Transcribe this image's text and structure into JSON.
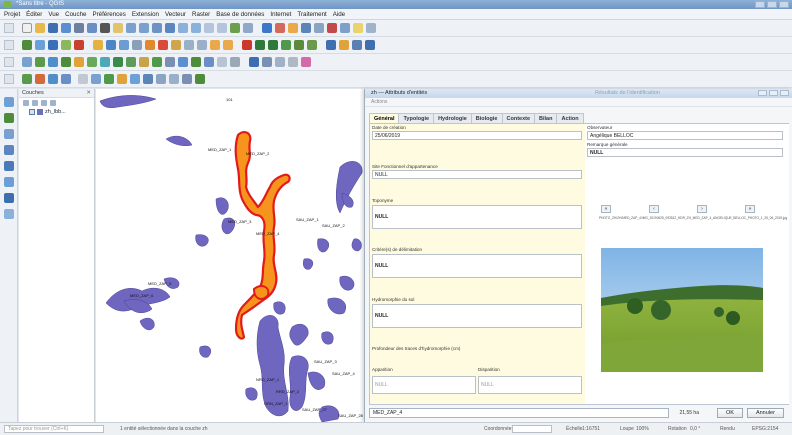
{
  "window": {
    "title": "*Sans titre - QGIS"
  },
  "menu": [
    "Projet",
    "Éditer",
    "Vue",
    "Couche",
    "Préférences",
    "Extension",
    "Vecteur",
    "Raster",
    "Base de données",
    "Internet",
    "Traitement",
    "Aide"
  ],
  "layers_panel": {
    "title": "Couches",
    "layer_name": "zh_lbb..."
  },
  "map_labels": {
    "l1": "MED_ZAP_1",
    "l2": "MED_ZAP_2",
    "l3": "MED_ZAP_3",
    "l4": "MED_ZAP_4",
    "l5": "MED_ZAP_5",
    "l6": "MED_ZAP_6",
    "l7": "SAU_ZAP_1",
    "l8": "SAU_ZAP_2",
    "l9": "SAU_ZAP_3",
    "l10": "SAU_ZAP_4",
    "l11": "NRD_ZAP_1",
    "l12": "RRD_ZAP_2",
    "l13": "ORN_ZAP_1",
    "l14": "SAU_ZAP_27",
    "l15": "SAU_ZAP_28",
    "top": "101"
  },
  "dialog": {
    "title": "zh — Attributs d'entités",
    "title_right": "Résultats de l'identification",
    "subtitle": "Actions",
    "tabs": [
      "Général",
      "Typologie",
      "Hydrologie",
      "Biologie",
      "Contexte",
      "Bilan",
      "Action"
    ],
    "fields": {
      "date_label": "Date de création",
      "date_value": "25/06/2019",
      "site_label": "Site Fonctionnel d'appartenance",
      "site_value": "NULL",
      "toponyme_label": "Toponyme",
      "toponyme_value": "NULL",
      "criteres_label": "Critère(s) de délimitation",
      "criteres_value": "NULL",
      "hydro_label": "Hydromorphie du sol",
      "hydro_value": "NULL",
      "profondeur_label": "Profondeur des traces d'hydromorphie (cm)",
      "apparition_label": "Apparition",
      "apparition_value": "NULL",
      "disparition_label": "Disparition",
      "disparition_value": "NULL",
      "observateur_label": "Observateur",
      "observateur_value": "Angélique BELLOC",
      "remarque_label": "Remarque générale",
      "remarque_value": "NULL"
    },
    "photo_path": "PHOTO_ZH/ZH/MED_ZAP_4/IMG_20190625_093512_HDR_ZH_MED_ZAP_4_ANGELIQUE_BELLOC_PHOTO_1_25_06_2019.jpg",
    "nav": [
      "«",
      "‹",
      "›",
      "»"
    ],
    "feature_select": "MED_ZAP_4",
    "area": "21,55 ha",
    "ok": "OK",
    "cancel": "Annuler"
  },
  "statusbar": {
    "search_placeholder": "Tapez pour trouver (Ctrl+K)",
    "message": "1 entité sélectionnée dans la couche zh",
    "coord_label": "Coordonnée",
    "scale_label": "Échelle",
    "scale_value": "1:16751",
    "loupe_label": "Loupe",
    "loupe_value": "100%",
    "rotation_label": "Rotation",
    "rotation_value": "0,0 °",
    "render_label": "Rendu",
    "epsg": "EPSG:2154"
  },
  "colors": {
    "wetland_fill": "#6f66c0",
    "selected_fill": "#f7941d",
    "selected_stroke": "#e31a1c",
    "form_bg": "#fffbe0"
  }
}
